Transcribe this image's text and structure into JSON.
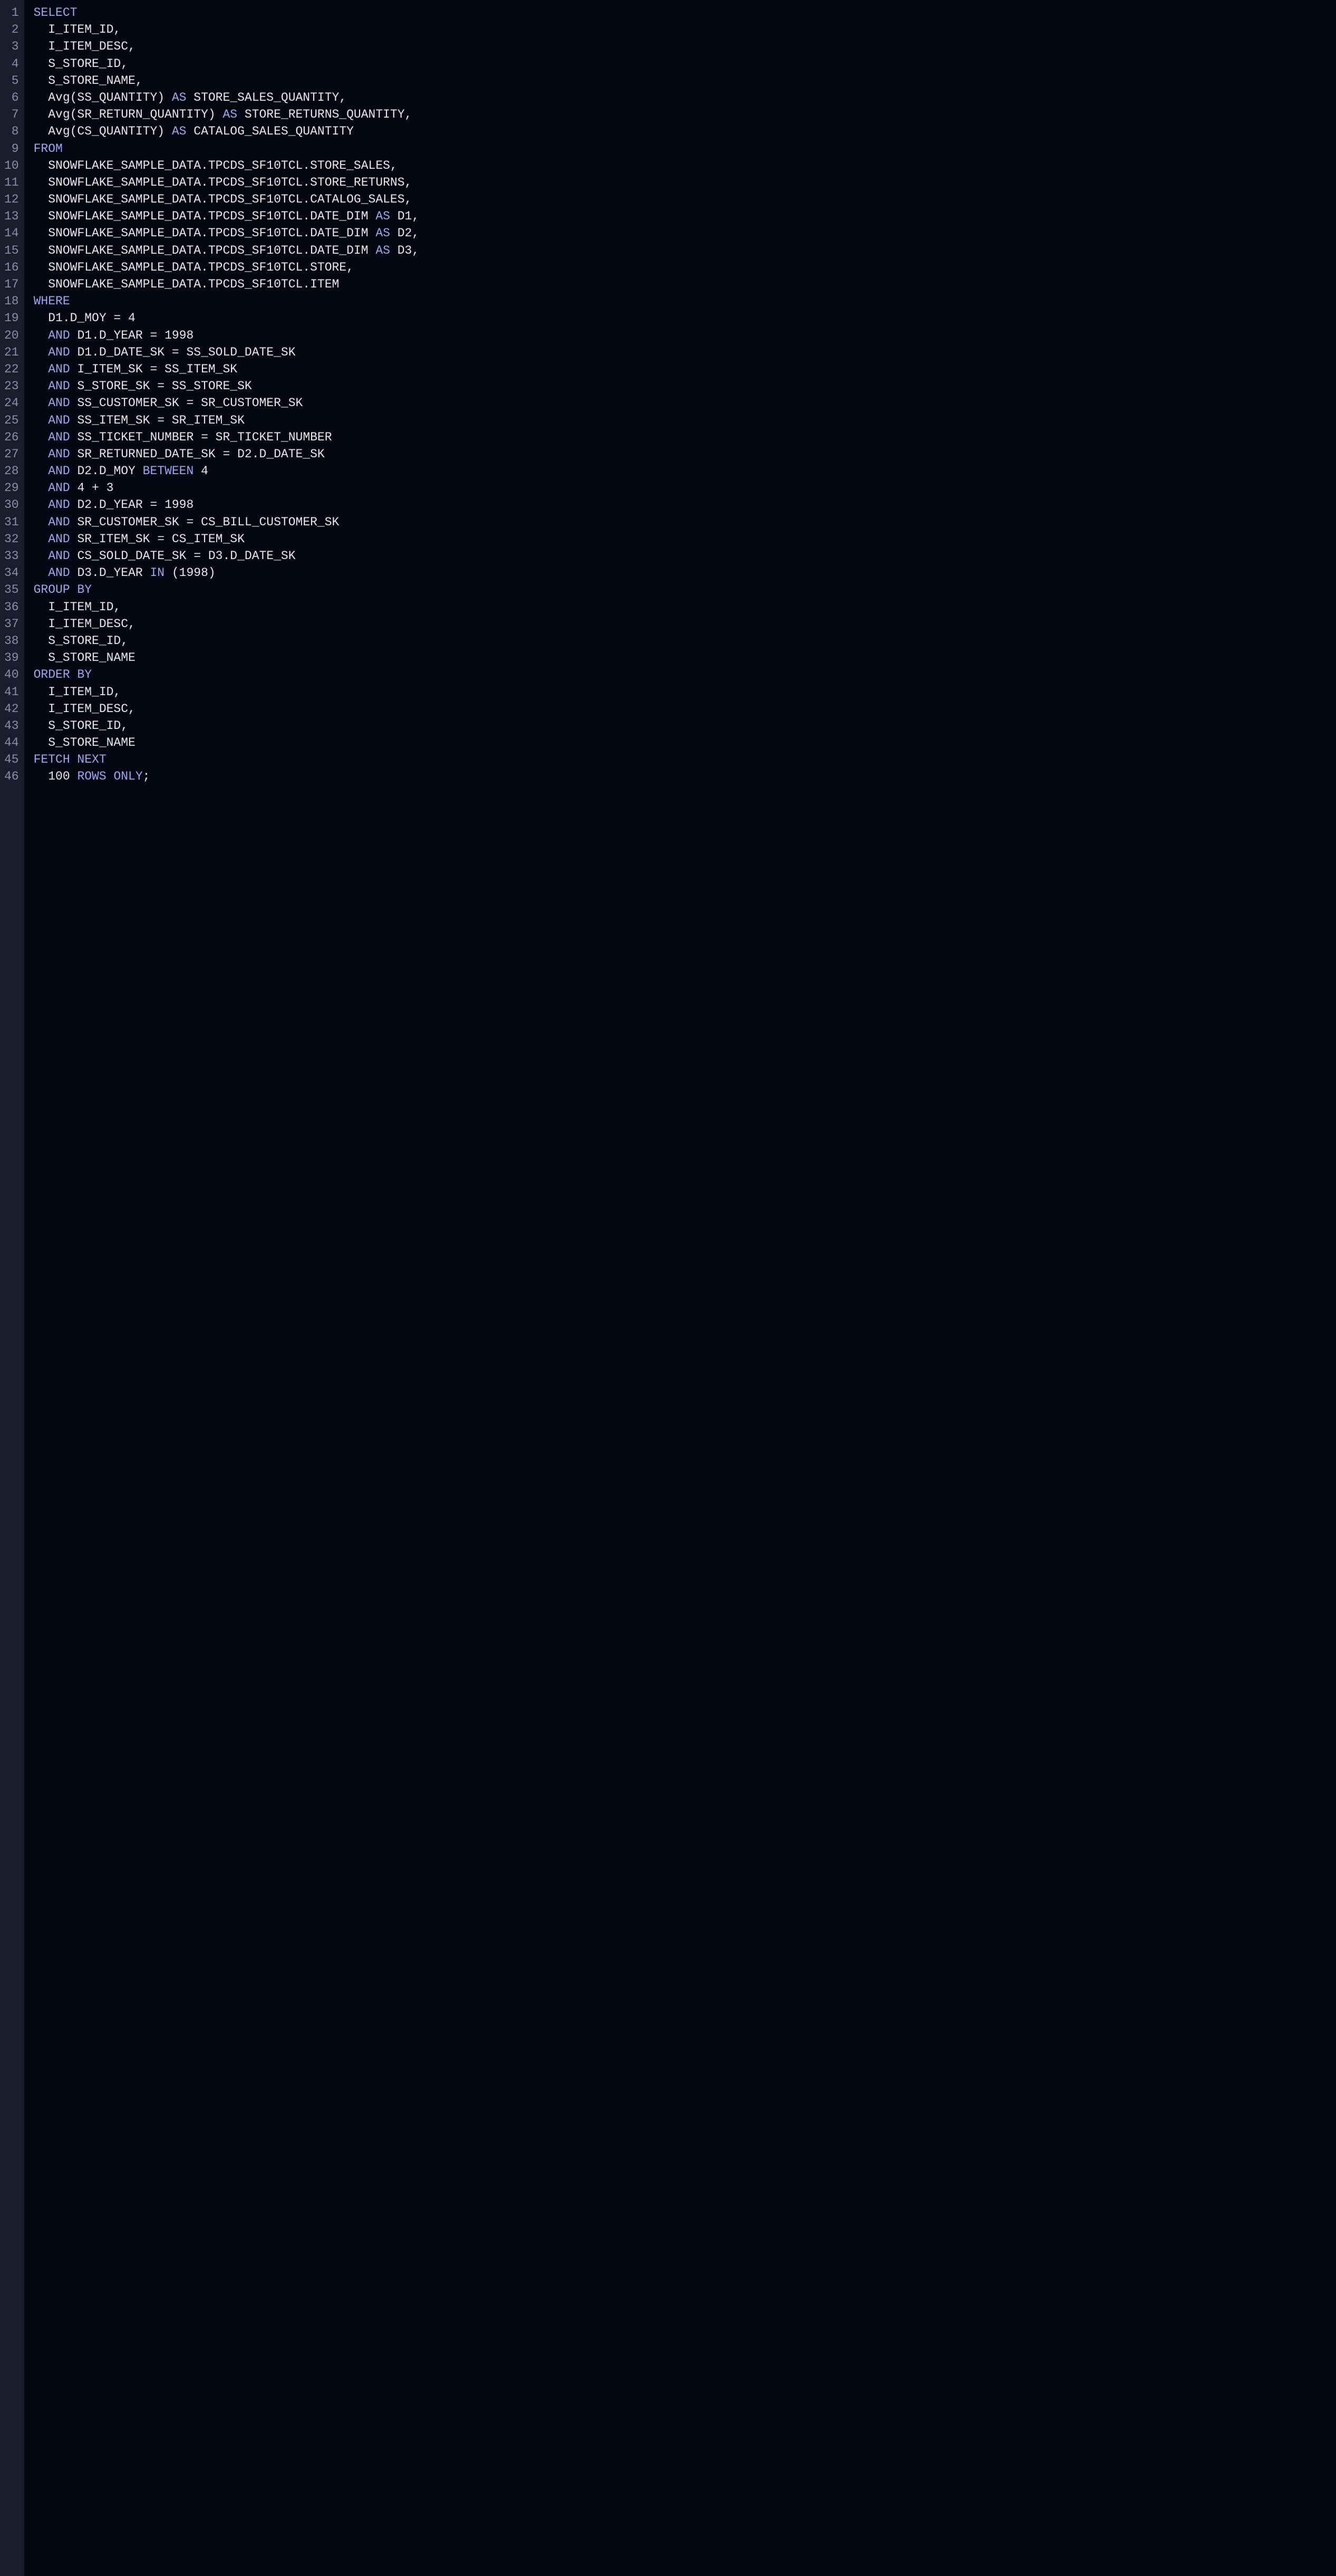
{
  "lineNumbers": [
    "1",
    "2",
    "3",
    "4",
    "5",
    "6",
    "7",
    "8",
    "9",
    "10",
    "11",
    "12",
    "13",
    "14",
    "15",
    "16",
    "17",
    "18",
    "19",
    "20",
    "21",
    "22",
    "23",
    "24",
    "25",
    "26",
    "27",
    "28",
    "29",
    "30",
    "31",
    "32",
    "33",
    "34",
    "35",
    "36",
    "37",
    "38",
    "39",
    "40",
    "41",
    "42",
    "43",
    "44",
    "45",
    "46"
  ],
  "lines": [
    [
      {
        "t": "keyword",
        "v": "SELECT"
      }
    ],
    [
      {
        "t": "text",
        "v": "  I_ITEM_ID,"
      }
    ],
    [
      {
        "t": "text",
        "v": "  I_ITEM_DESC,"
      }
    ],
    [
      {
        "t": "text",
        "v": "  S_STORE_ID,"
      }
    ],
    [
      {
        "t": "text",
        "v": "  S_STORE_NAME,"
      }
    ],
    [
      {
        "t": "text",
        "v": "  Avg(SS_QUANTITY) "
      },
      {
        "t": "keyword",
        "v": "AS"
      },
      {
        "t": "text",
        "v": " STORE_SALES_QUANTITY,"
      }
    ],
    [
      {
        "t": "text",
        "v": "  Avg(SR_RETURN_QUANTITY) "
      },
      {
        "t": "keyword",
        "v": "AS"
      },
      {
        "t": "text",
        "v": " STORE_RETURNS_QUANTITY,"
      }
    ],
    [
      {
        "t": "text",
        "v": "  Avg(CS_QUANTITY) "
      },
      {
        "t": "keyword",
        "v": "AS"
      },
      {
        "t": "text",
        "v": " CATALOG_SALES_QUANTITY"
      }
    ],
    [
      {
        "t": "keyword",
        "v": "FROM"
      }
    ],
    [
      {
        "t": "text",
        "v": "  SNOWFLAKE_SAMPLE_DATA.TPCDS_SF10TCL.STORE_SALES,"
      }
    ],
    [
      {
        "t": "text",
        "v": "  SNOWFLAKE_SAMPLE_DATA.TPCDS_SF10TCL.STORE_RETURNS,"
      }
    ],
    [
      {
        "t": "text",
        "v": "  SNOWFLAKE_SAMPLE_DATA.TPCDS_SF10TCL.CATALOG_SALES,"
      }
    ],
    [
      {
        "t": "text",
        "v": "  SNOWFLAKE_SAMPLE_DATA.TPCDS_SF10TCL.DATE_DIM "
      },
      {
        "t": "keyword",
        "v": "AS"
      },
      {
        "t": "text",
        "v": " D1,"
      }
    ],
    [
      {
        "t": "text",
        "v": "  SNOWFLAKE_SAMPLE_DATA.TPCDS_SF10TCL.DATE_DIM "
      },
      {
        "t": "keyword",
        "v": "AS"
      },
      {
        "t": "text",
        "v": " D2,"
      }
    ],
    [
      {
        "t": "text",
        "v": "  SNOWFLAKE_SAMPLE_DATA.TPCDS_SF10TCL.DATE_DIM "
      },
      {
        "t": "keyword",
        "v": "AS"
      },
      {
        "t": "text",
        "v": " D3,"
      }
    ],
    [
      {
        "t": "text",
        "v": "  SNOWFLAKE_SAMPLE_DATA.TPCDS_SF10TCL.STORE,"
      }
    ],
    [
      {
        "t": "text",
        "v": "  SNOWFLAKE_SAMPLE_DATA.TPCDS_SF10TCL.ITEM"
      }
    ],
    [
      {
        "t": "keyword",
        "v": "WHERE"
      }
    ],
    [
      {
        "t": "text",
        "v": "  D1.D_MOY = 4"
      }
    ],
    [
      {
        "t": "text",
        "v": "  "
      },
      {
        "t": "keyword",
        "v": "AND"
      },
      {
        "t": "text",
        "v": " D1.D_YEAR = 1998"
      }
    ],
    [
      {
        "t": "text",
        "v": "  "
      },
      {
        "t": "keyword",
        "v": "AND"
      },
      {
        "t": "text",
        "v": " D1.D_DATE_SK = SS_SOLD_DATE_SK"
      }
    ],
    [
      {
        "t": "text",
        "v": "  "
      },
      {
        "t": "keyword",
        "v": "AND"
      },
      {
        "t": "text",
        "v": " I_ITEM_SK = SS_ITEM_SK"
      }
    ],
    [
      {
        "t": "text",
        "v": "  "
      },
      {
        "t": "keyword",
        "v": "AND"
      },
      {
        "t": "text",
        "v": " S_STORE_SK = SS_STORE_SK"
      }
    ],
    [
      {
        "t": "text",
        "v": "  "
      },
      {
        "t": "keyword",
        "v": "AND"
      },
      {
        "t": "text",
        "v": " SS_CUSTOMER_SK = SR_CUSTOMER_SK"
      }
    ],
    [
      {
        "t": "text",
        "v": "  "
      },
      {
        "t": "keyword",
        "v": "AND"
      },
      {
        "t": "text",
        "v": " SS_ITEM_SK = SR_ITEM_SK"
      }
    ],
    [
      {
        "t": "text",
        "v": "  "
      },
      {
        "t": "keyword",
        "v": "AND"
      },
      {
        "t": "text",
        "v": " SS_TICKET_NUMBER = SR_TICKET_NUMBER"
      }
    ],
    [
      {
        "t": "text",
        "v": "  "
      },
      {
        "t": "keyword",
        "v": "AND"
      },
      {
        "t": "text",
        "v": " SR_RETURNED_DATE_SK = D2.D_DATE_SK"
      }
    ],
    [
      {
        "t": "text",
        "v": "  "
      },
      {
        "t": "keyword",
        "v": "AND"
      },
      {
        "t": "text",
        "v": " D2.D_MOY "
      },
      {
        "t": "keyword",
        "v": "BETWEEN"
      },
      {
        "t": "text",
        "v": " 4"
      }
    ],
    [
      {
        "t": "text",
        "v": "  "
      },
      {
        "t": "keyword",
        "v": "AND"
      },
      {
        "t": "text",
        "v": " 4 + 3"
      }
    ],
    [
      {
        "t": "text",
        "v": "  "
      },
      {
        "t": "keyword",
        "v": "AND"
      },
      {
        "t": "text",
        "v": " D2.D_YEAR = 1998"
      }
    ],
    [
      {
        "t": "text",
        "v": "  "
      },
      {
        "t": "keyword",
        "v": "AND"
      },
      {
        "t": "text",
        "v": " SR_CUSTOMER_SK = CS_BILL_CUSTOMER_SK"
      }
    ],
    [
      {
        "t": "text",
        "v": "  "
      },
      {
        "t": "keyword",
        "v": "AND"
      },
      {
        "t": "text",
        "v": " SR_ITEM_SK = CS_ITEM_SK"
      }
    ],
    [
      {
        "t": "text",
        "v": "  "
      },
      {
        "t": "keyword",
        "v": "AND"
      },
      {
        "t": "text",
        "v": " CS_SOLD_DATE_SK = D3.D_DATE_SK"
      }
    ],
    [
      {
        "t": "text",
        "v": "  "
      },
      {
        "t": "keyword",
        "v": "AND"
      },
      {
        "t": "text",
        "v": " D3.D_YEAR "
      },
      {
        "t": "keyword",
        "v": "IN"
      },
      {
        "t": "text",
        "v": " (1998)"
      }
    ],
    [
      {
        "t": "keyword",
        "v": "GROUP BY"
      }
    ],
    [
      {
        "t": "text",
        "v": "  I_ITEM_ID,"
      }
    ],
    [
      {
        "t": "text",
        "v": "  I_ITEM_DESC,"
      }
    ],
    [
      {
        "t": "text",
        "v": "  S_STORE_ID,"
      }
    ],
    [
      {
        "t": "text",
        "v": "  S_STORE_NAME"
      }
    ],
    [
      {
        "t": "keyword",
        "v": "ORDER BY"
      }
    ],
    [
      {
        "t": "text",
        "v": "  I_ITEM_ID,"
      }
    ],
    [
      {
        "t": "text",
        "v": "  I_ITEM_DESC,"
      }
    ],
    [
      {
        "t": "text",
        "v": "  S_STORE_ID,"
      }
    ],
    [
      {
        "t": "text",
        "v": "  S_STORE_NAME"
      }
    ],
    [
      {
        "t": "keyword",
        "v": "FETCH NEXT"
      }
    ],
    [
      {
        "t": "text",
        "v": "  100 "
      },
      {
        "t": "keyword",
        "v": "ROWS ONLY"
      },
      {
        "t": "text",
        "v": ";"
      }
    ]
  ]
}
